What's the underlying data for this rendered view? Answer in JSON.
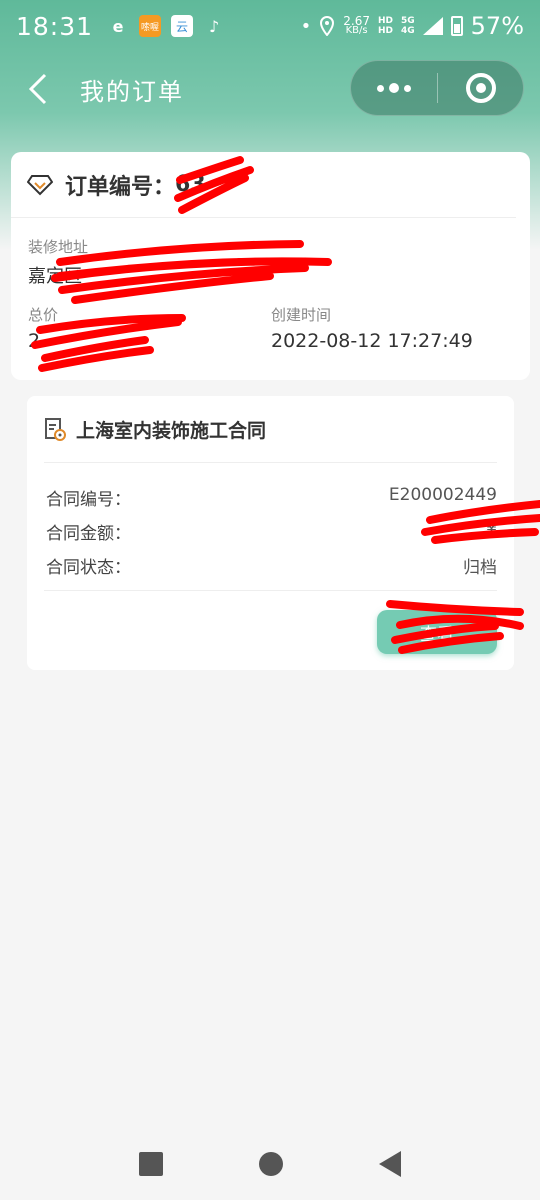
{
  "status_bar": {
    "time": "18:31",
    "net_speed_value": "2.67",
    "net_speed_unit": "KB/s",
    "sim_5g": "5G",
    "sim_4g": "4G",
    "battery": "57%",
    "apps": [
      {
        "name": "weibo-app-icon",
        "label": "e"
      },
      {
        "name": "orange-app-icon",
        "label": "嗦喔"
      },
      {
        "name": "cloud-app-icon",
        "label": "云"
      },
      {
        "name": "tiktok-app-icon",
        "label": "♪"
      }
    ]
  },
  "nav": {
    "title": "我的订单"
  },
  "order": {
    "number_label": "订单编号：",
    "number_value": "63",
    "address_label": "装修地址",
    "address_value": "嘉定区",
    "total_label": "总价",
    "total_value": "2",
    "created_label": "创建时间",
    "created_value": "2022-08-12 17:27:49"
  },
  "contract": {
    "title": "上海室内装饰施工合同",
    "rows": [
      {
        "label": "合同编号：",
        "value": "E200002449"
      },
      {
        "label": "合同金额：",
        "value": "¥"
      },
      {
        "label": "合同状态：",
        "value": "归档"
      }
    ],
    "button_label": "查看"
  },
  "colors": {
    "header_green": "#5fb99a",
    "button_green": "#75cbb3",
    "redaction_red": "#ff0000"
  }
}
